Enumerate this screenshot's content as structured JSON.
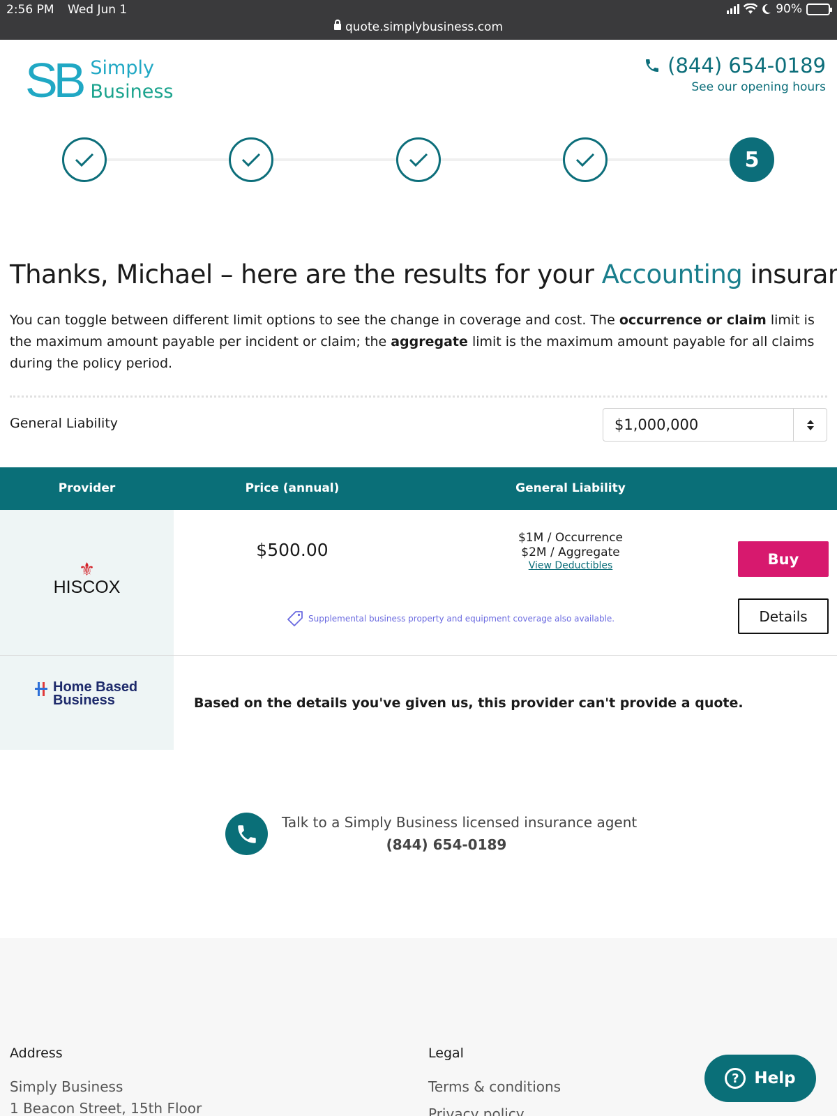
{
  "status_bar": {
    "time": "2:56 PM",
    "date": "Wed Jun 1",
    "battery": "90%",
    "url": "quote.simplybusiness.com"
  },
  "header": {
    "logo_mark": "SB",
    "logo_line1": "Simply",
    "logo_line2": "Business",
    "phone": "(844) 654-0189",
    "hours_link": "See our opening hours"
  },
  "stepper": {
    "steps": [
      "done",
      "done",
      "done",
      "done",
      "current"
    ],
    "current_label": "5"
  },
  "results": {
    "title_before": "Thanks, Michael – here are the results for your ",
    "title_accent": "Accounting",
    "title_after": " insurance",
    "intro_1": "You can toggle between different limit options to see the change in coverage and cost. The ",
    "intro_bold_1": "occurrence or claim",
    "intro_2": " limit is the maximum amount payable per incident or claim; the ",
    "intro_bold_2": "aggregate",
    "intro_3": " limit is the maximum amount payable for all claims during the policy period.",
    "limit_label": "General Liability",
    "limit_value": "$1,000,000"
  },
  "table": {
    "columns": [
      "Provider",
      "Price (annual)",
      "General Liability"
    ],
    "rows": [
      {
        "provider": "HISCOX",
        "price": "$500.00",
        "occurrence": "$1M / Occurrence",
        "aggregate": "$2M / Aggregate",
        "deductibles_link": "View Deductibles",
        "supplemental": "Supplemental business property and equipment coverage also available.",
        "buy_label": "Buy",
        "details_label": "Details"
      },
      {
        "provider_line1": "Home Based",
        "provider_line2": "Business",
        "message": "Based on the details you've given us, this provider can't provide a quote."
      }
    ]
  },
  "agent": {
    "text": "Talk to a Simply Business licensed insurance agent",
    "phone": "(844) 654-0189"
  },
  "footer": {
    "address_heading": "Address",
    "address_line1": "Simply Business",
    "address_line2": "1 Beacon Street, 15th Floor",
    "legal_heading": "Legal",
    "legal_item1": "Terms & conditions",
    "legal_item2": "Privacy policy"
  },
  "help_button": "Help",
  "colors": {
    "brand_teal": "#0a6f78",
    "buy_pink": "#d7196e",
    "logo_blue": "#20a8c4"
  }
}
